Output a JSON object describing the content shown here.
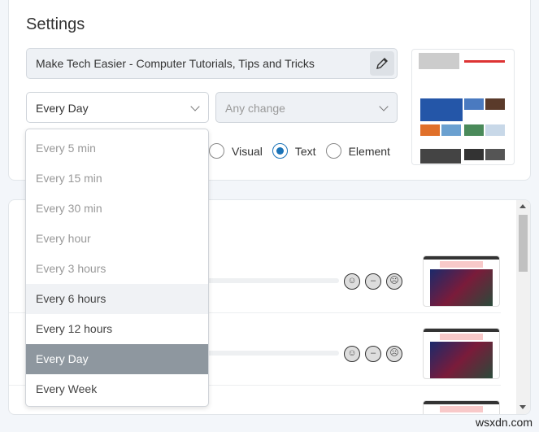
{
  "settings": {
    "title": "Settings",
    "url": "Make Tech Easier - Computer Tutorials, Tips and Tricks",
    "frequency": "Every Day",
    "change_type_placeholder": "Any change",
    "modes": [
      {
        "label": "Visual",
        "checked": false
      },
      {
        "label": "Text",
        "checked": true
      },
      {
        "label": "Element",
        "checked": false
      }
    ]
  },
  "menu": {
    "items": [
      "Every 5 min",
      "Every 15 min",
      "Every 30 min",
      "Every hour",
      "Every 3 hours",
      "Every 6 hours",
      "Every 12 hours",
      "Every Day",
      "Every Week"
    ],
    "selected": "Every Day",
    "hovered": "Every 6 hours"
  },
  "list": {
    "reactions": [
      "happy-face-icon",
      "neutral-face-icon",
      "sad-face-icon"
    ]
  },
  "watermark": "wsxdn.com",
  "colors": {
    "accent": "#1a73b8",
    "selected_bg": "#8e979f"
  }
}
